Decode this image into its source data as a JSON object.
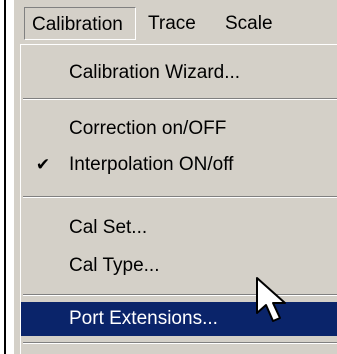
{
  "menubar": {
    "items": [
      {
        "label": "Calibration",
        "pressed": true
      },
      {
        "label": "Trace"
      },
      {
        "label": "Scale"
      }
    ]
  },
  "calibration_menu": {
    "items": [
      {
        "label": "Calibration Wizard..."
      },
      {
        "label": "Correction on/OFF"
      },
      {
        "label": "Interpolation ON/off",
        "checked": true
      },
      {
        "label": "Cal Set..."
      },
      {
        "label": "Cal Type..."
      },
      {
        "label": "Port Extensions...",
        "highlighted": true
      }
    ],
    "check_icon": "checkmark-icon"
  },
  "cursor": {
    "icon": "mouse-pointer-icon"
  },
  "colors": {
    "menu_background": "#d4d0c8",
    "highlight_background": "#0a246a",
    "highlight_text": "#ffffff"
  }
}
